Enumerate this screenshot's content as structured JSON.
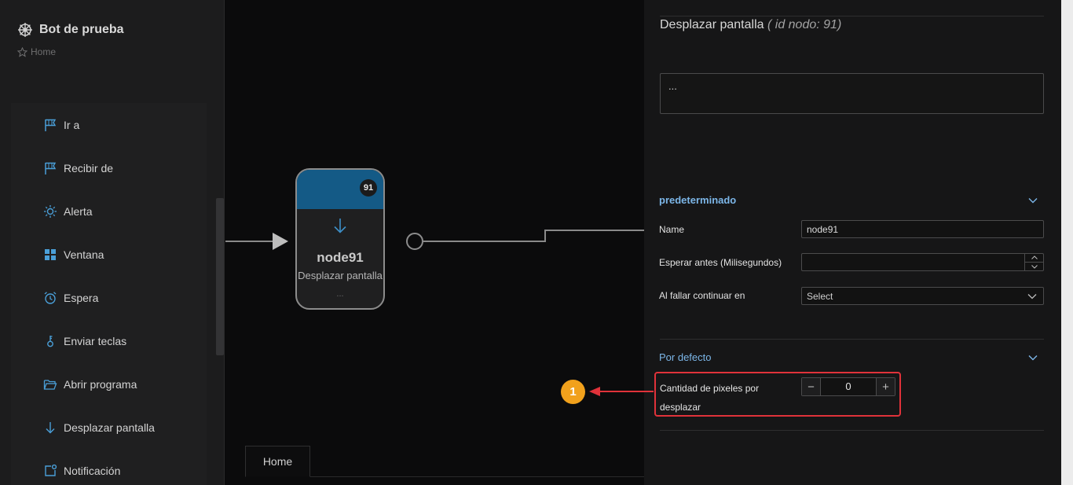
{
  "sidebar": {
    "title": "Bot de prueba",
    "home_label": "Home",
    "items": [
      {
        "label": "Ir a",
        "icon": "flag-icon"
      },
      {
        "label": "Recibir de",
        "icon": "flag-icon"
      },
      {
        "label": "Alerta",
        "icon": "sun-icon"
      },
      {
        "label": "Ventana",
        "icon": "window-grid-icon"
      },
      {
        "label": "Espera",
        "icon": "alarm-clock-icon"
      },
      {
        "label": "Enviar teclas",
        "icon": "key-icon"
      },
      {
        "label": "Abrir programa",
        "icon": "folder-open-icon"
      },
      {
        "label": "Desplazar pantalla",
        "icon": "arrow-down-icon"
      },
      {
        "label": "Notificación",
        "icon": "notification-icon"
      }
    ]
  },
  "canvas": {
    "node": {
      "id": "91",
      "title": "node91",
      "subtitle": "Desplazar pantalla",
      "placeholder": "..."
    },
    "tab_label": "Home"
  },
  "panel": {
    "title": "Desplazar pantalla",
    "node_id_text": "( id nodo: 91)",
    "description": "...",
    "section_default": {
      "title": "predeterminado",
      "name_label": "Name",
      "name_value": "node91",
      "wait_label": "Esperar antes (Milisegundos)",
      "wait_value": "",
      "fail_label": "Al fallar continuar en",
      "fail_value": "Select"
    },
    "section_por_defecto": {
      "title": "Por defecto",
      "pixels_label": "Cantidad de pixeles por desplazar",
      "pixels_value": "0",
      "minus": "−",
      "plus": "+"
    }
  },
  "callout": {
    "number": "1",
    "color": "#e0323a",
    "badge_color": "#f1a11c"
  },
  "colors": {
    "accent": "#7cb6e8",
    "node_header": "#145a86",
    "icon_blue": "#4a9fd8"
  }
}
